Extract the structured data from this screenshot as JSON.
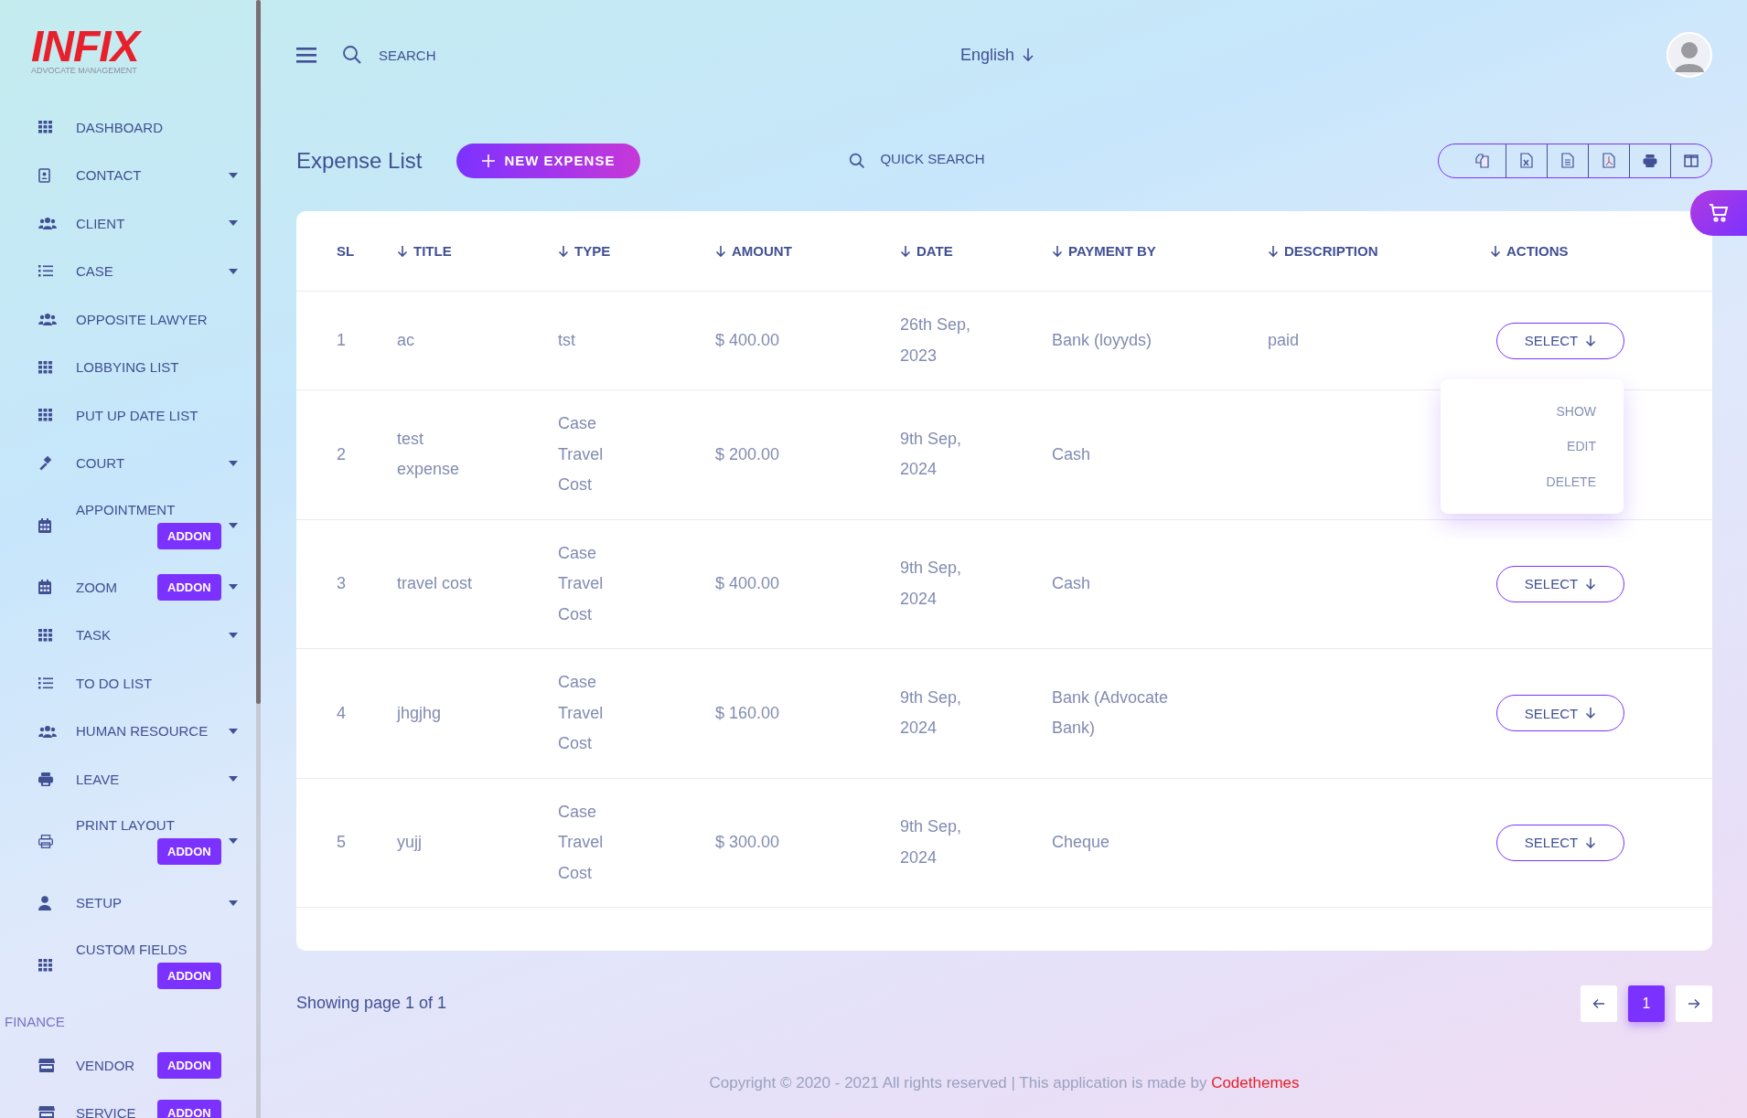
{
  "logo": {
    "name": "INFIX",
    "tagline": "ADVOCATE MANAGEMENT"
  },
  "sidebar": {
    "items": [
      {
        "kind": "item",
        "label": "DASHBOARD",
        "submenu": false
      },
      {
        "kind": "item",
        "label": "CONTACT",
        "submenu": true
      },
      {
        "kind": "item",
        "label": "CLIENT",
        "submenu": true
      },
      {
        "kind": "item",
        "label": "CASE",
        "submenu": true
      },
      {
        "kind": "item",
        "label": "OPPOSITE LAWYER",
        "submenu": false
      },
      {
        "kind": "item",
        "label": "LOBBYING LIST",
        "submenu": false
      },
      {
        "kind": "item",
        "label": "PUT UP DATE LIST",
        "submenu": false
      },
      {
        "kind": "item",
        "label": "COURT",
        "submenu": true
      },
      {
        "kind": "stacked",
        "label": "APPOINTMENT",
        "submenu": true,
        "addon": "ADDON"
      },
      {
        "kind": "item",
        "label": "ZOOM",
        "submenu": true,
        "addon": "ADDON"
      },
      {
        "kind": "item",
        "label": "TASK",
        "submenu": true
      },
      {
        "kind": "item",
        "label": "TO DO LIST",
        "submenu": false
      },
      {
        "kind": "item",
        "label": "HUMAN RESOURCE",
        "submenu": true
      },
      {
        "kind": "item",
        "label": "LEAVE",
        "submenu": true
      },
      {
        "kind": "stacked",
        "label": "PRINT LAYOUT",
        "submenu": true,
        "addon": "ADDON"
      },
      {
        "kind": "item",
        "label": "SETUP",
        "submenu": true
      },
      {
        "kind": "stacked",
        "label": "CUSTOM FIELDS",
        "submenu": false,
        "addon": "ADDON"
      },
      {
        "kind": "section",
        "label": "FINANCE"
      },
      {
        "kind": "item",
        "label": "VENDOR",
        "submenu": false,
        "addon": "ADDON"
      },
      {
        "kind": "item",
        "label": "SERVICE",
        "submenu": false,
        "addon": "ADDON"
      }
    ]
  },
  "topbar": {
    "search": {
      "placeholder": "SEARCH"
    },
    "language": "English"
  },
  "page": {
    "title": "Expense List",
    "new_button": "NEW EXPENSE",
    "quick_search": {
      "placeholder": "QUICK SEARCH"
    },
    "export_buttons": [
      {
        "kind": "copy"
      },
      {
        "kind": "excel"
      },
      {
        "kind": "csv"
      },
      {
        "kind": "pdf"
      },
      {
        "kind": "print"
      },
      {
        "kind": "columns"
      }
    ]
  },
  "table": {
    "columns": [
      {
        "label": "SL",
        "sortable": false
      },
      {
        "label": "TITLE",
        "sortable": true
      },
      {
        "label": "TYPE",
        "sortable": true
      },
      {
        "label": "AMOUNT",
        "sortable": true
      },
      {
        "label": "DATE",
        "sortable": true
      },
      {
        "label": "PAYMENT BY",
        "sortable": true
      },
      {
        "label": "DESCRIPTION",
        "sortable": true
      },
      {
        "label": "ACTIONS",
        "sortable": true
      }
    ],
    "rows": [
      {
        "sl": "1",
        "title": "ac",
        "type": "tst",
        "amount": "$ 400.00",
        "date": "26th Sep, 2023",
        "payment_by": "Bank (loyyds)",
        "description": "paid",
        "action": "SELECT",
        "menu_open": true
      },
      {
        "sl": "2",
        "title": "test expense",
        "type": "Case Travel Cost",
        "amount": "$ 200.00",
        "date": "9th Sep, 2024",
        "payment_by": "Cash",
        "menu_open": false
      },
      {
        "sl": "3",
        "title": "travel cost",
        "type": "Case Travel Cost",
        "amount": "$ 400.00",
        "date": "9th Sep, 2024",
        "payment_by": "Cash",
        "action": "SELECT",
        "menu_open": false
      },
      {
        "sl": "4",
        "title": "jhgjhg",
        "type": "Case Travel Cost",
        "amount": "$ 160.00",
        "date": "9th Sep, 2024",
        "payment_by": "Bank (Advocate Bank)",
        "action": "SELECT",
        "menu_open": false
      },
      {
        "sl": "5",
        "title": "yujj",
        "type": "Case Travel Cost",
        "amount": "$ 300.00",
        "date": "9th Sep, 2024",
        "payment_by": "Cheque",
        "action": "SELECT",
        "menu_open": false
      }
    ]
  },
  "action_menu": [
    "SHOW",
    "EDIT",
    "DELETE"
  ],
  "pagination": {
    "summary": "Showing page 1 of 1",
    "pages": [
      {
        "label": "1",
        "selected": true
      }
    ]
  },
  "footer": {
    "text": "Copyright © 2020 - 2021 All rights reserved | This application is made by",
    "link": "Codethemes"
  }
}
